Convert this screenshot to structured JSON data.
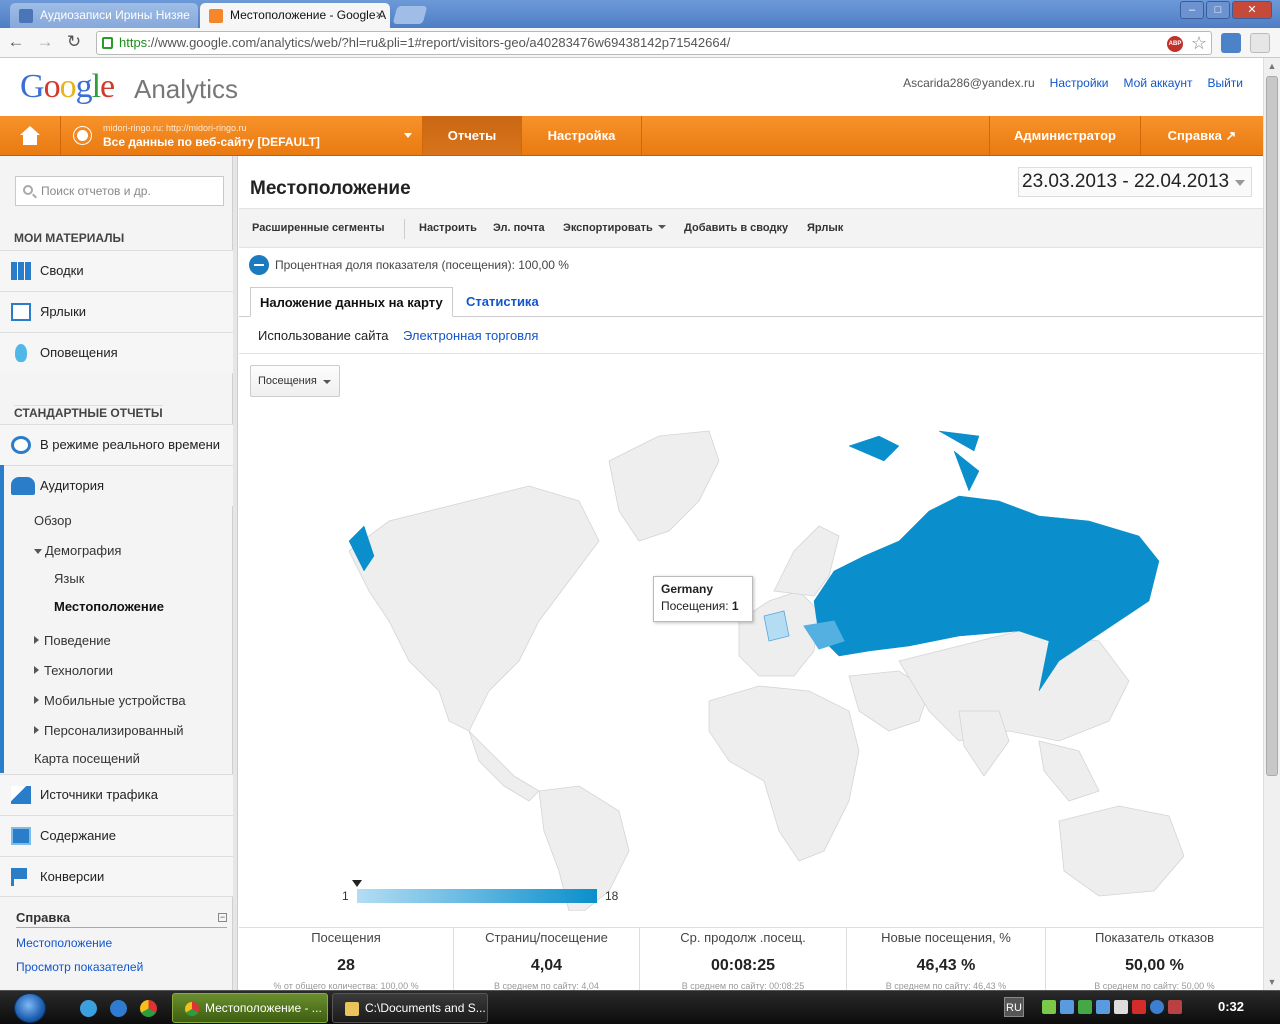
{
  "browser": {
    "tabs": [
      {
        "title": "Аудиозаписи Ирины Низяе",
        "active": false
      },
      {
        "title": "Местоположение - Google A",
        "active": true
      }
    ],
    "url_scheme": "https",
    "url_rest": "://www.google.com/analytics/web/?hl=ru&pli=1#report/visitors-geo/a40283476w69438142p71542664/",
    "abp_label": "ABP"
  },
  "header": {
    "logo_letters": [
      "G",
      "o",
      "o",
      "g",
      "l",
      "e"
    ],
    "logo_colors": [
      "#3b6fd6",
      "#d13b2e",
      "#e8b21c",
      "#3b6fd6",
      "#2f9c3e",
      "#d13b2e"
    ],
    "product": "Analytics",
    "email": "Ascarida286@yandex.ru",
    "settings_link": "Настройки",
    "account_link": "Мой аккаунт",
    "logout_link": "Выйти"
  },
  "nav": {
    "account_sub": "midori-ringo.ru: http://midori-ringo.ru",
    "account_main": "Все данные по веб-сайту [DEFAULT]",
    "reports": "Отчеты",
    "setup": "Настройка",
    "admin": "Администратор",
    "help": "Справка ↗"
  },
  "sidebar": {
    "search_placeholder": "Поиск отчетов и др.",
    "my_materials": "МОИ МАТЕРИАЛЫ",
    "dashboards": "Сводки",
    "shortcuts": "Ярлыки",
    "alerts": "Оповещения",
    "standard_reports": "СТАНДАРТНЫЕ ОТЧЕТЫ",
    "realtime": "В режиме реального времени",
    "audience": "Аудитория",
    "overview": "Обзор",
    "demographics": "Демография",
    "language": "Язык",
    "location": "Местоположение",
    "behavior": "Поведение",
    "technology": "Технологии",
    "mobile": "Мобильные устройства",
    "custom": "Персонализированный",
    "visitors_flow": "Карта посещений",
    "traffic_sources": "Источники трафика",
    "content": "Содержание",
    "conversions": "Конверсии",
    "help_heading": "Справка",
    "help_links": [
      "Местоположение",
      "Просмотр показателей"
    ]
  },
  "report": {
    "title": "Местоположение",
    "date_start": "23.03.2013",
    "date_sep": "-",
    "date_end": "22.04.2013",
    "actions": {
      "segments": "Расширенные сегменты",
      "customize": "Настроить",
      "email": "Эл. почта",
      "export": "Экспортировать",
      "add_to_dashboard": "Добавить в сводку",
      "shortcut": "Ярлык"
    },
    "segment_text": "Процентная доля показателя (посещения): 100,00 %",
    "tabs": {
      "map_overlay": "Наложение данных на карту",
      "stats": "Статистика"
    },
    "subtabs": {
      "site_usage": "Использование сайта",
      "ecommerce": "Электронная торговля"
    },
    "metric_select": "Посещения",
    "tooltip": {
      "country": "Germany",
      "label": "Посещения:",
      "value": "1"
    },
    "legend": {
      "min": "1",
      "max": "18"
    },
    "colors": {
      "max": "#0a8fcc",
      "min": "#b4ddf4",
      "mid": "#54b0e0",
      "no_data": "#eeeeee"
    },
    "summary": [
      {
        "label": "Посещения",
        "value": "28",
        "sub": "% от общего количества: 100,00 %"
      },
      {
        "label": "Страниц/посещение",
        "value": "4,04",
        "sub": "В среднем по сайту: 4,04"
      },
      {
        "label": "Ср. продолж .посещ.",
        "value": "00:08:25",
        "sub": "В среднем по сайту: 00:08:25"
      },
      {
        "label": "Новые посещения, %",
        "value": "46,43 %",
        "sub": "В среднем по сайту: 46,43 %"
      },
      {
        "label": "Показатель отказов",
        "value": "50,00 %",
        "sub": "В среднем по сайту: 50,00 %"
      }
    ]
  },
  "taskbar": {
    "items": [
      "Местоположение - ...",
      "C:\\Documents and S..."
    ],
    "lang": "RU",
    "time": "0:32"
  }
}
